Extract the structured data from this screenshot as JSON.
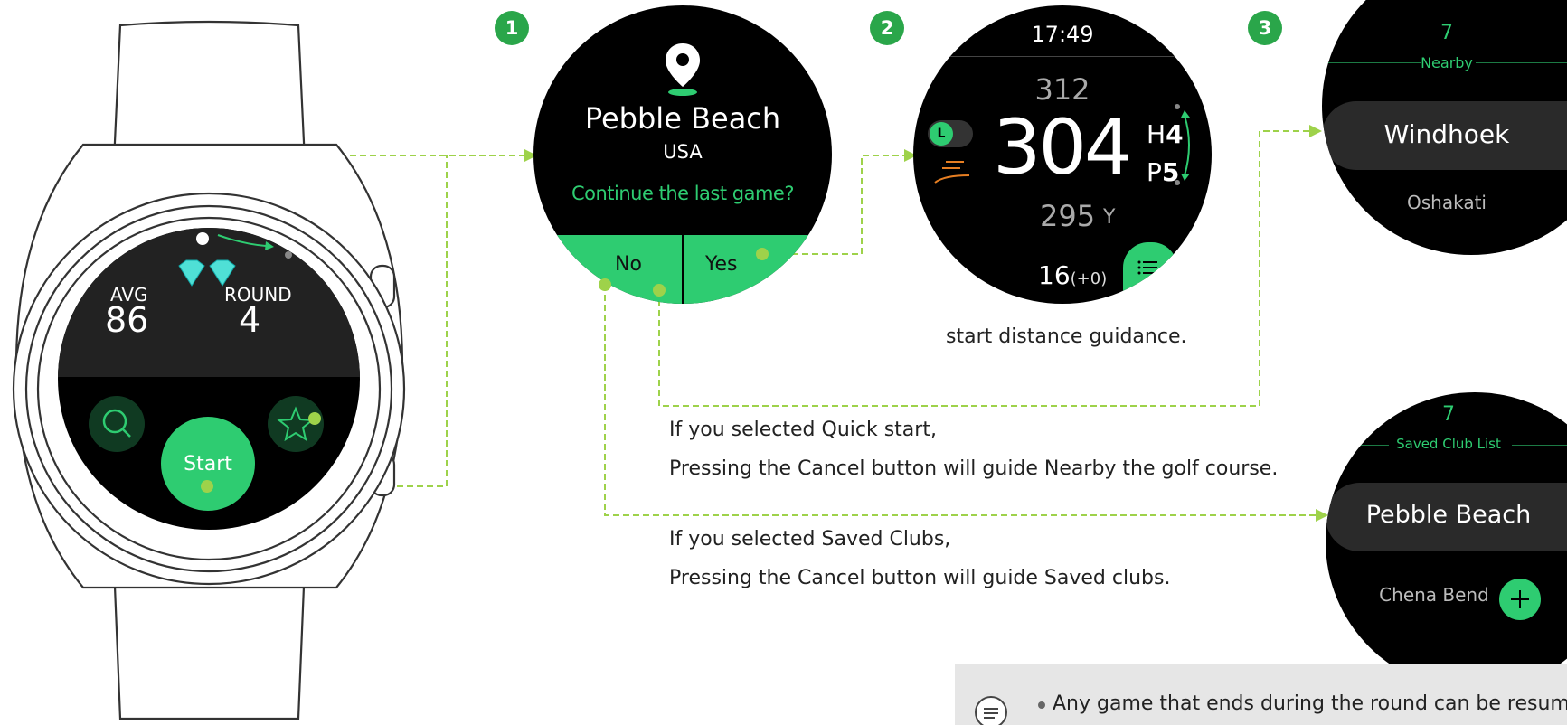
{
  "watch": {
    "avg_label": "AVG",
    "avg_value": "86",
    "round_label": "ROUND",
    "round_value": "4",
    "start_label": "Start"
  },
  "step1": {
    "badge": "1",
    "course_name": "Pebble Beach",
    "country": "USA",
    "prompt": "Continue the last game?",
    "no_label": "No",
    "yes_label": "Yes"
  },
  "step2": {
    "badge": "2",
    "time": "17:49",
    "back_distance": "312",
    "main_distance": "304",
    "front_distance": "295",
    "unit": "Y",
    "hole_prefix": "H",
    "hole_number": "4",
    "par_prefix": "P",
    "par_number": "5",
    "score": "16",
    "score_delta": "(+0)",
    "lr_label": "L",
    "caption": "start distance guidance."
  },
  "step3": {
    "badge": "3",
    "nearby": {
      "count": "7",
      "title": "Nearby",
      "selected": "Windhoek",
      "next": "Oshakati"
    },
    "saved": {
      "count": "7",
      "title": "Saved Club List",
      "selected": "Pebble Beach",
      "next": "Chena Bend"
    }
  },
  "descriptions": {
    "quick_1": "If you selected Quick start,",
    "quick_2": "Pressing the Cancel button will guide Nearby the golf course.",
    "saved_1": "If you selected Saved Clubs,",
    "saved_2": "Pressing the Cancel button will guide Saved clubs."
  },
  "note": {
    "text": "Any game that ends during the round can be resum"
  },
  "colors": {
    "accent_green": "#2ecc71",
    "connector_green": "#9ed24a",
    "badge_green": "#2aa64a",
    "screen_black": "#000000",
    "note_bg": "#e6e6e6"
  }
}
